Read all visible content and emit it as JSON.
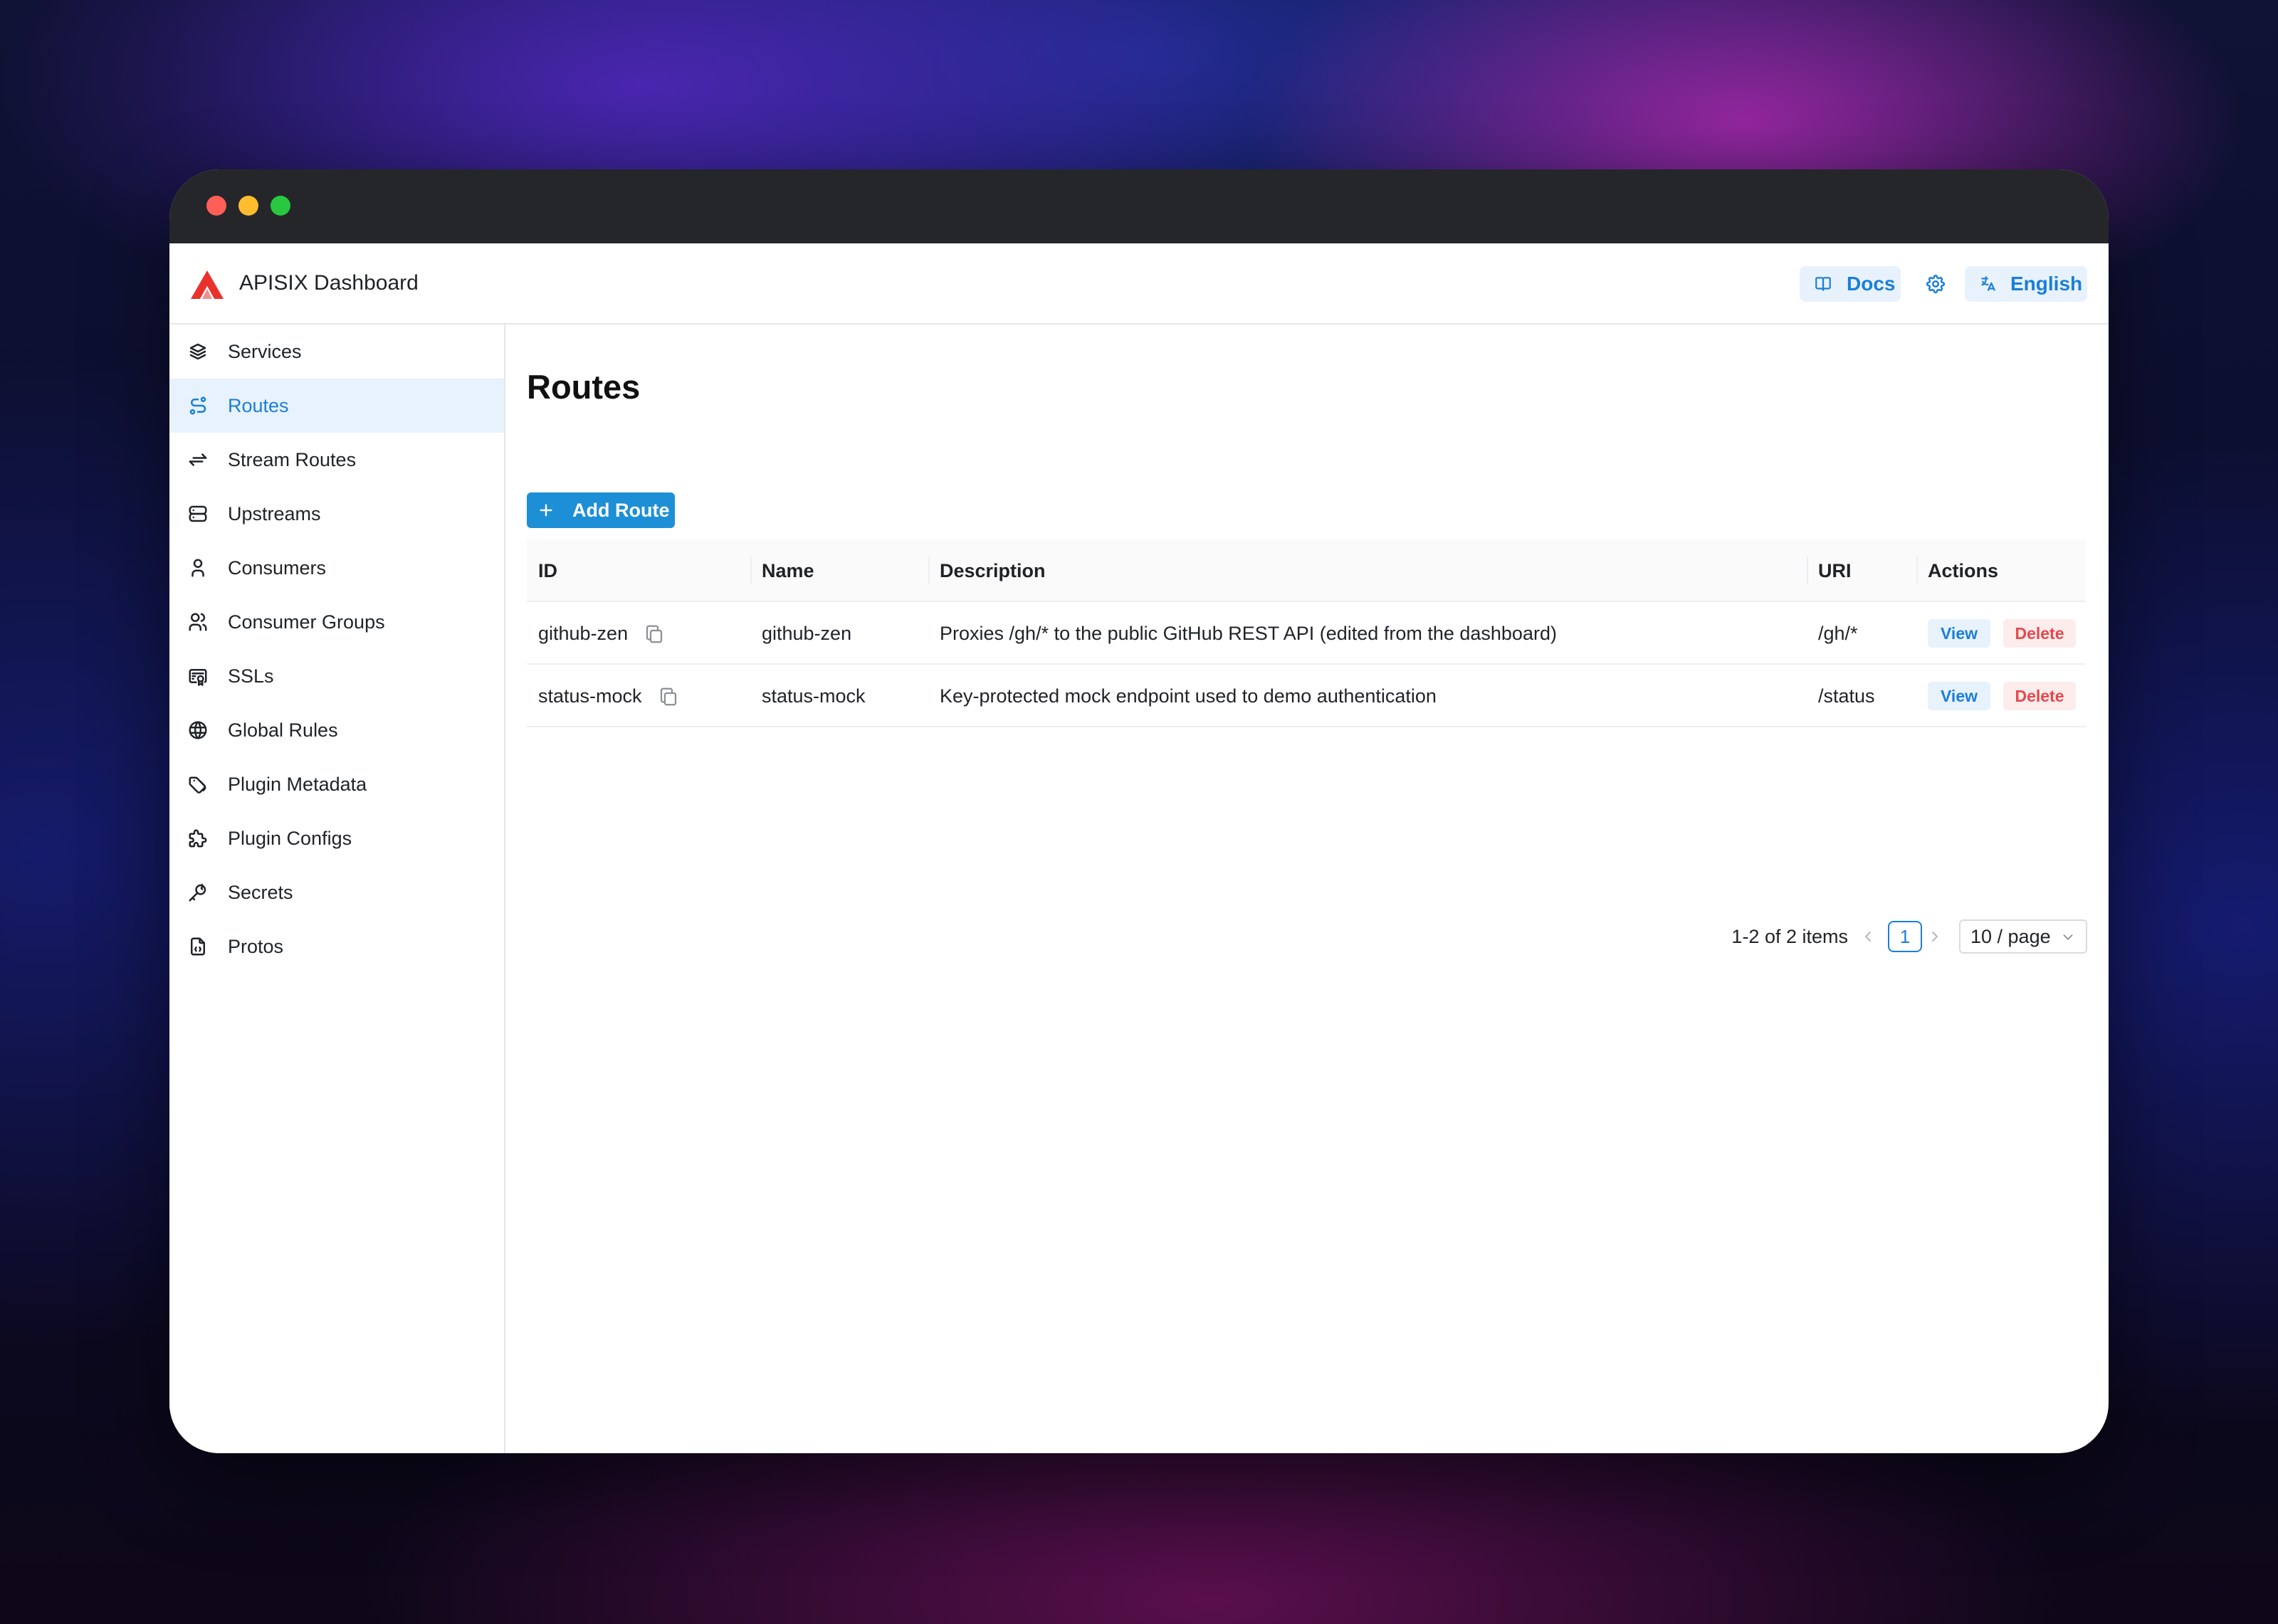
{
  "app": {
    "title": "APISIX Dashboard"
  },
  "header": {
    "docs_label": "Docs",
    "language_label": "English"
  },
  "sidebar": {
    "items": [
      {
        "label": "Services",
        "icon": "layers-icon"
      },
      {
        "label": "Routes",
        "icon": "route-icon",
        "active": true
      },
      {
        "label": "Stream Routes",
        "icon": "arrows-exchange-icon"
      },
      {
        "label": "Upstreams",
        "icon": "server-icon"
      },
      {
        "label": "Consumers",
        "icon": "user-icon"
      },
      {
        "label": "Consumer Groups",
        "icon": "users-icon"
      },
      {
        "label": "SSLs",
        "icon": "certificate-icon"
      },
      {
        "label": "Global Rules",
        "icon": "globe-icon"
      },
      {
        "label": "Plugin Metadata",
        "icon": "tags-icon"
      },
      {
        "label": "Plugin Configs",
        "icon": "puzzle-icon"
      },
      {
        "label": "Secrets",
        "icon": "key-icon"
      },
      {
        "label": "Protos",
        "icon": "file-code-icon"
      }
    ]
  },
  "main": {
    "title": "Routes",
    "add_button_label": "Add Route",
    "table": {
      "columns": [
        "ID",
        "Name",
        "Description",
        "URI",
        "Actions"
      ],
      "rows": [
        {
          "id": "github-zen",
          "name": "github-zen",
          "description": "Proxies /gh/* to the public GitHub REST API (edited from the dashboard)",
          "uri": "/gh/*",
          "view_label": "View",
          "delete_label": "Delete"
        },
        {
          "id": "status-mock",
          "name": "status-mock",
          "description": "Key-protected mock endpoint used to demo authentication",
          "uri": "/status",
          "view_label": "View",
          "delete_label": "Delete"
        }
      ]
    },
    "pagination": {
      "total_text": "1-2 of 2 items",
      "current_page": "1",
      "page_size": "10 / page"
    }
  },
  "colors": {
    "accent": "#1a7fd8",
    "danger": "#e5484d",
    "logo": "#e8322b",
    "titlebar": "#25262a"
  }
}
